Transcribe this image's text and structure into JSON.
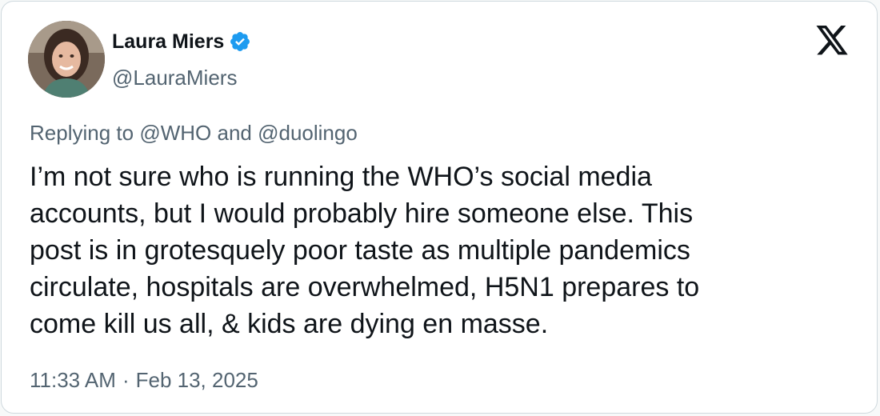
{
  "author": {
    "display_name": "Laura Miers",
    "handle": "@LauraMiers",
    "verified": true,
    "verified_color": "#1d9bf0"
  },
  "reply": {
    "prefix": "Replying to",
    "to_1": "@WHO",
    "joiner": "and",
    "to_2": "@duolingo"
  },
  "tweet": {
    "text": "I’m not sure who is running the WHO’s social media\naccounts, but I would probably hire someone else. This\npost is in grotesquely poor taste as multiple pandemics\ncirculate, hospitals are overwhelmed, H5N1 prepares to\ncome kill us all, & kids are dying en masse."
  },
  "meta": {
    "time": "11:33 AM",
    "separator": "·",
    "date": "Feb 13, 2025"
  },
  "icons": {
    "platform_logo": "x-logo-icon",
    "verified_badge": "verified-badge-icon"
  }
}
